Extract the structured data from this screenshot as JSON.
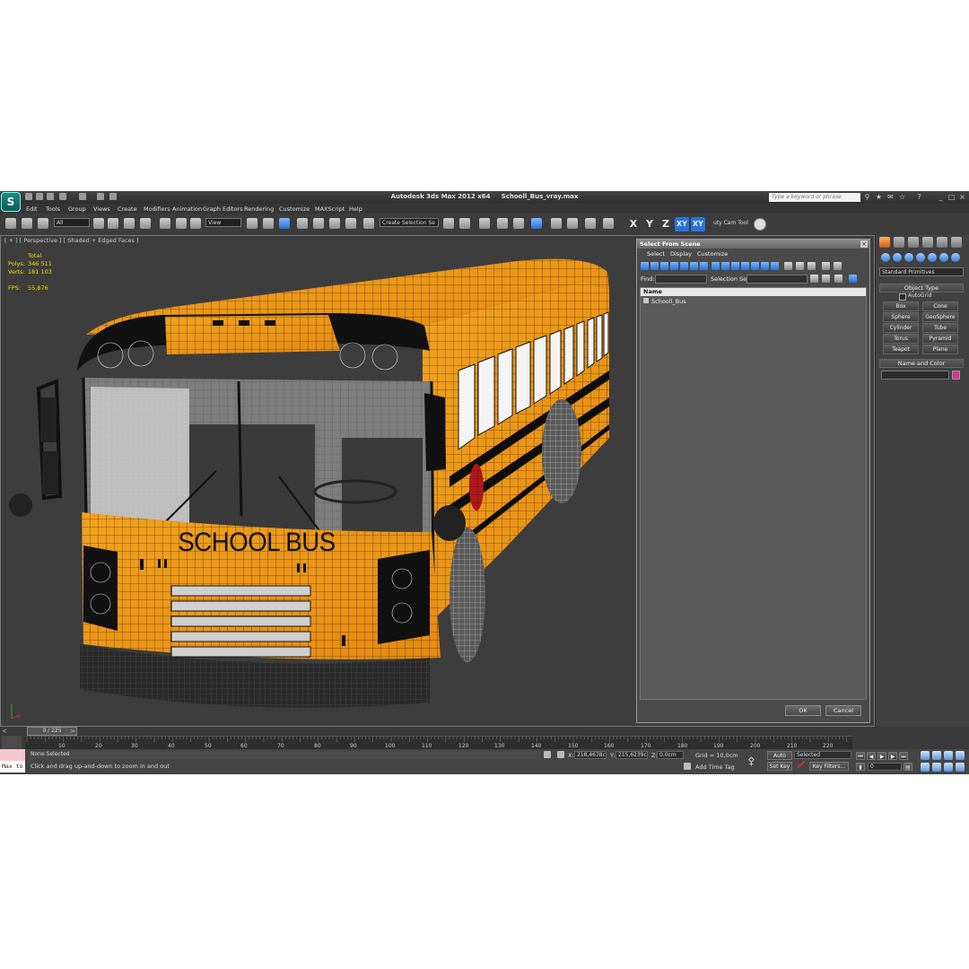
{
  "title": {
    "app": "Autodesk 3ds Max  2012 x64",
    "file": "Schooll_Bus_vray.max"
  },
  "search": {
    "placeholder": "Type a keyword or phrase"
  },
  "menu": [
    "Edit",
    "Tools",
    "Group",
    "Views",
    "Create",
    "Modifiers",
    "Animation",
    "Graph Editors",
    "Rendering",
    "Customize",
    "MAXScript",
    "Help"
  ],
  "toolbar": {
    "selection_filter": "All",
    "ref_coord": "View",
    "named_selection": "Create Selection Se",
    "axes": [
      "X",
      "Y",
      "Z"
    ],
    "plane": "XY",
    "plane_alt": "XY",
    "cam_tool": "uty Cam Tool"
  },
  "viewport": {
    "label": "[ + ] [ Perspective ] [ Shaded + Edged Faces ]",
    "stats": {
      "total_label": "Total",
      "polys_label": "Polys:",
      "polys": "346 511",
      "verts_label": "Verts:",
      "verts": "181 103",
      "fps_label": "FPS:",
      "fps": "55,876"
    },
    "bus_sign": "SCHOOL BUS"
  },
  "dialog": {
    "title": "Select From Scene",
    "menu": [
      "Select",
      "Display",
      "Customize"
    ],
    "find_label": "Find:",
    "selset_label": "Selection Set:",
    "list_header": "Name",
    "items": [
      "Schooll_Bus"
    ],
    "ok": "OK",
    "cancel": "Cancel"
  },
  "command_panel": {
    "dropdown": "Standard Primitives",
    "object_type": "Object Type",
    "autogrid": "AutoGrid",
    "buttons": [
      "Box",
      "Cone",
      "Sphere",
      "GeoSphere",
      "Cylinder",
      "Tube",
      "Torus",
      "Pyramid",
      "Teapot",
      "Plane"
    ],
    "name_color": "Name and Color",
    "swatch_color": "#e0308a"
  },
  "timeline": {
    "slider": "0 / 225",
    "frames": [
      "10",
      "20",
      "30",
      "40",
      "50",
      "60",
      "70",
      "80",
      "90",
      "100",
      "110",
      "120",
      "130",
      "140",
      "150",
      "160",
      "170",
      "180",
      "190",
      "200",
      "210",
      "220"
    ]
  },
  "status": {
    "maxscript": "Max to",
    "selection": "None Selected",
    "prompt": "Click and drag up-and-down to zoom in and out",
    "x_label": "X:",
    "x": "218,4678c",
    "y_label": "Y:",
    "y": "215,6239c",
    "z_label": "Z:",
    "z": "0,0cm",
    "grid": "Grid = 10,0cm",
    "add_time_tag": "Add Time Tag",
    "auto_key": "Auto Key",
    "set_key": "Set Key",
    "key_mode": "Selected",
    "key_filters": "Key Filters...",
    "frame": "0"
  }
}
